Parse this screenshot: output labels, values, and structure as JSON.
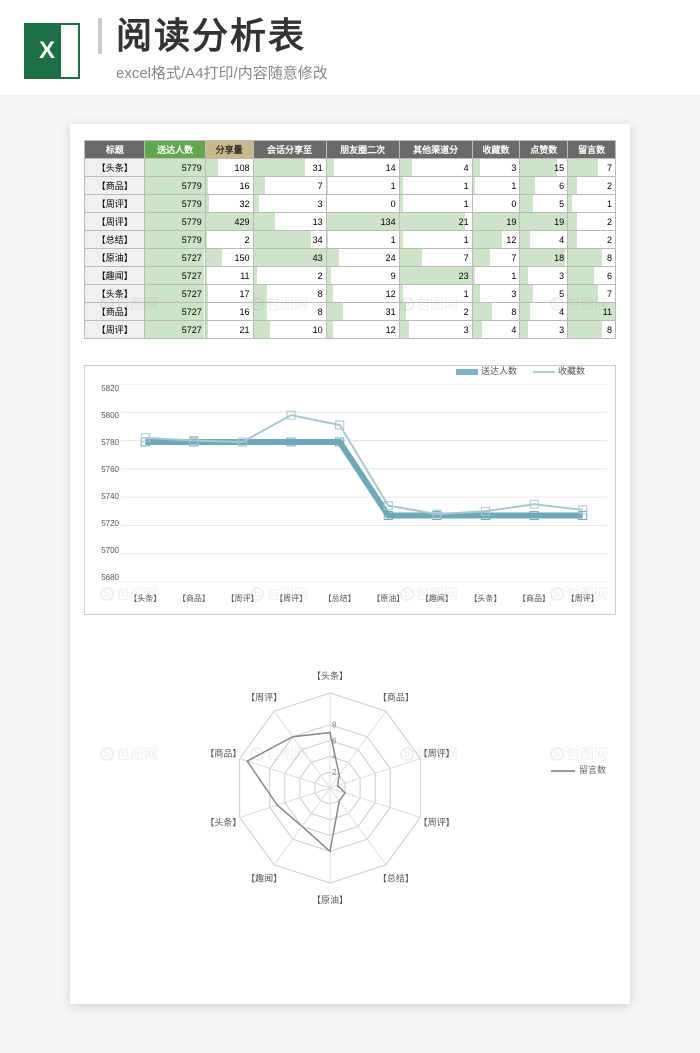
{
  "header": {
    "icon_letter": "X",
    "title": "阅读分析表",
    "subtitle": "excel格式/A4打印/内容随意修改"
  },
  "table": {
    "columns": [
      "标题",
      "送达人数",
      "分享量",
      "会话分享至",
      "朋友圈二次",
      "其他渠道分",
      "收藏数",
      "点赞数",
      "留言数"
    ],
    "rows": [
      {
        "label": "【头条】",
        "cells": [
          5779,
          108,
          31,
          14,
          4,
          3,
          15,
          7
        ]
      },
      {
        "label": "【商品】",
        "cells": [
          5779,
          16,
          7,
          1,
          1,
          1,
          6,
          2
        ]
      },
      {
        "label": "【周评】",
        "cells": [
          5779,
          32,
          3,
          0,
          1,
          0,
          5,
          1
        ]
      },
      {
        "label": "【周评】",
        "cells": [
          5779,
          429,
          13,
          134,
          21,
          19,
          19,
          2
        ]
      },
      {
        "label": "【总结】",
        "cells": [
          5779,
          2,
          34,
          1,
          1,
          12,
          4,
          2
        ]
      },
      {
        "label": "【原油】",
        "cells": [
          5727,
          150,
          43,
          24,
          7,
          7,
          18,
          8
        ]
      },
      {
        "label": "【趣闻】",
        "cells": [
          5727,
          11,
          2,
          9,
          23,
          1,
          3,
          6
        ]
      },
      {
        "label": "【头条】",
        "cells": [
          5727,
          17,
          8,
          12,
          1,
          3,
          5,
          7
        ]
      },
      {
        "label": "【商品】",
        "cells": [
          5727,
          16,
          8,
          31,
          2,
          8,
          4,
          11
        ]
      },
      {
        "label": "【周评】",
        "cells": [
          5727,
          21,
          10,
          12,
          3,
          4,
          3,
          8
        ]
      }
    ],
    "col_max": [
      5779,
      429,
      43,
      134,
      23,
      19,
      19,
      11
    ]
  },
  "chart_data": [
    {
      "type": "line",
      "title": "",
      "categories": [
        "【头条】",
        "【商品】",
        "【周评】",
        "【周评】",
        "【总结】",
        "【原油】",
        "【趣闻】",
        "【头条】",
        "【商品】",
        "【周评】"
      ],
      "series": [
        {
          "name": "送达人数",
          "values": [
            5779,
            5779,
            5779,
            5779,
            5779,
            5727,
            5727,
            5727,
            5727,
            5727
          ]
        },
        {
          "name": "收藏数",
          "values": [
            5782,
            5780,
            5779,
            5798,
            5791,
            5734,
            5728,
            5730,
            5735,
            5731
          ]
        }
      ],
      "ylim": [
        5680,
        5820
      ],
      "yticks": [
        5680,
        5700,
        5720,
        5740,
        5760,
        5780,
        5800,
        5820
      ],
      "xlabel": "",
      "ylabel": ""
    },
    {
      "type": "radar",
      "title": "",
      "categories": [
        "【头条】",
        "【商品】",
        "【周评】",
        "【周评】",
        "【总结】",
        "【原油】",
        "【趣闻】",
        "【头条】",
        "【商品】",
        "【周评】"
      ],
      "series": [
        {
          "name": "留言数",
          "values": [
            7,
            2,
            1,
            2,
            2,
            8,
            6,
            7,
            11,
            8
          ]
        }
      ],
      "rings": [
        2,
        4,
        6,
        8
      ],
      "max": 12
    }
  ],
  "legend_line": {
    "a": "送达人数",
    "b": "收藏数"
  },
  "legend_radar": "留言数",
  "watermark": "包图网"
}
